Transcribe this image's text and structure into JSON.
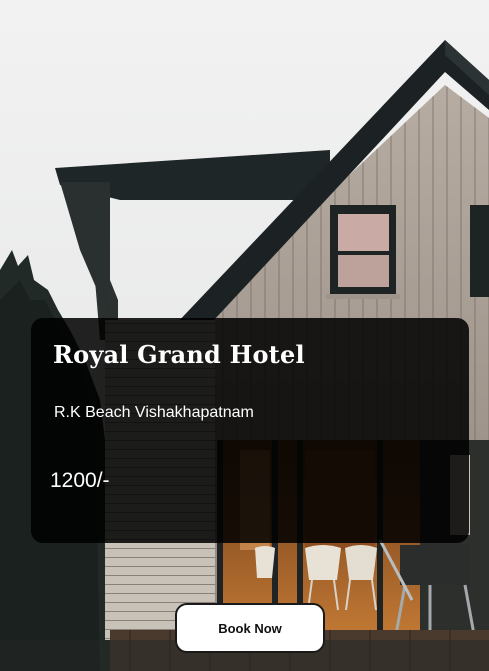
{
  "hotel": {
    "name": "Royal Grand Hotel",
    "location": "R.K Beach Vishakhapatnam",
    "price": "1200/-"
  },
  "actions": {
    "book_label": "Book Now"
  },
  "colors": {
    "card_background": "#000000",
    "text": "#ffffff",
    "button_background": "#ffffff",
    "button_text": "#111111"
  },
  "icons": {
    "background": "house-photo"
  }
}
